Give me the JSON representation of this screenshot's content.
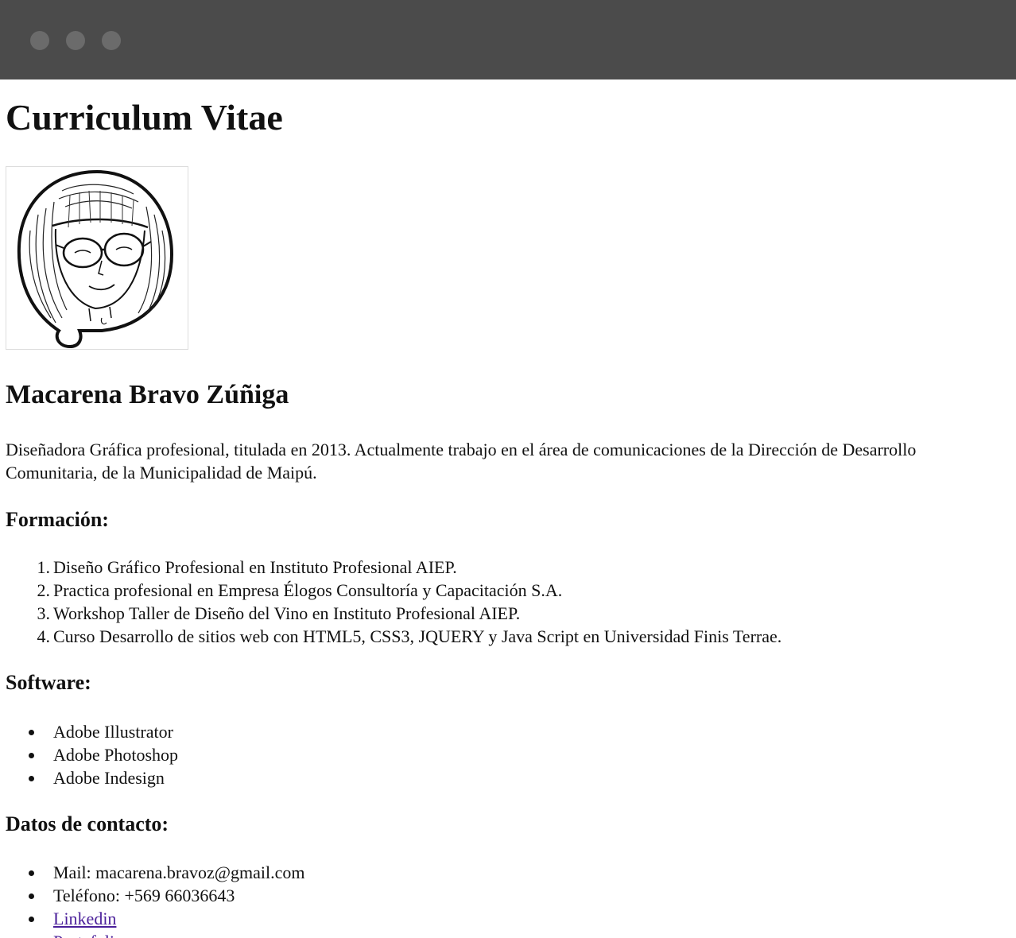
{
  "window": {
    "controls": [
      "close-dot",
      "minimize-dot",
      "zoom-dot"
    ]
  },
  "page": {
    "title": "Curriculum Vitae",
    "name": "Macarena Bravo Zúñiga",
    "bio": "Diseñadora Gráfica profesional, titulada en 2013. Actualmente trabajo en el área de comunicaciones de la Dirección de Desarrollo Comunitaria, de la Municipalidad de Maipú."
  },
  "formacion": {
    "heading": "Formación:",
    "items": [
      {
        "number": "1.",
        "text": "Diseño Gráfico Profesional en Instituto Profesional AIEP."
      },
      {
        "number": "2.",
        "text": "Practica profesional en Empresa Élogos Consultoría y Capacitación S.A."
      },
      {
        "number": "3.",
        "text": "Workshop Taller de Diseño del Vino en Instituto Profesional AIEP."
      },
      {
        "number": "4.",
        "text": "Curso Desarrollo de sitios web con HTML5, CSS3, JQUERY y Java Script en Universidad Finis Terrae."
      }
    ]
  },
  "software": {
    "heading": "Software:",
    "items": [
      "Adobe Illustrator",
      "Adobe Photoshop",
      "Adobe Indesign"
    ]
  },
  "contacto": {
    "heading": "Datos de contacto:",
    "mail": "Mail: macarena.bravoz@gmail.com",
    "phone": "Teléfono: +569 66036643",
    "linkedin": "Linkedin",
    "portfolio": "Portafolio"
  },
  "colors": {
    "titlebar": "#4b4b4b",
    "link": "#4a1f9a"
  }
}
